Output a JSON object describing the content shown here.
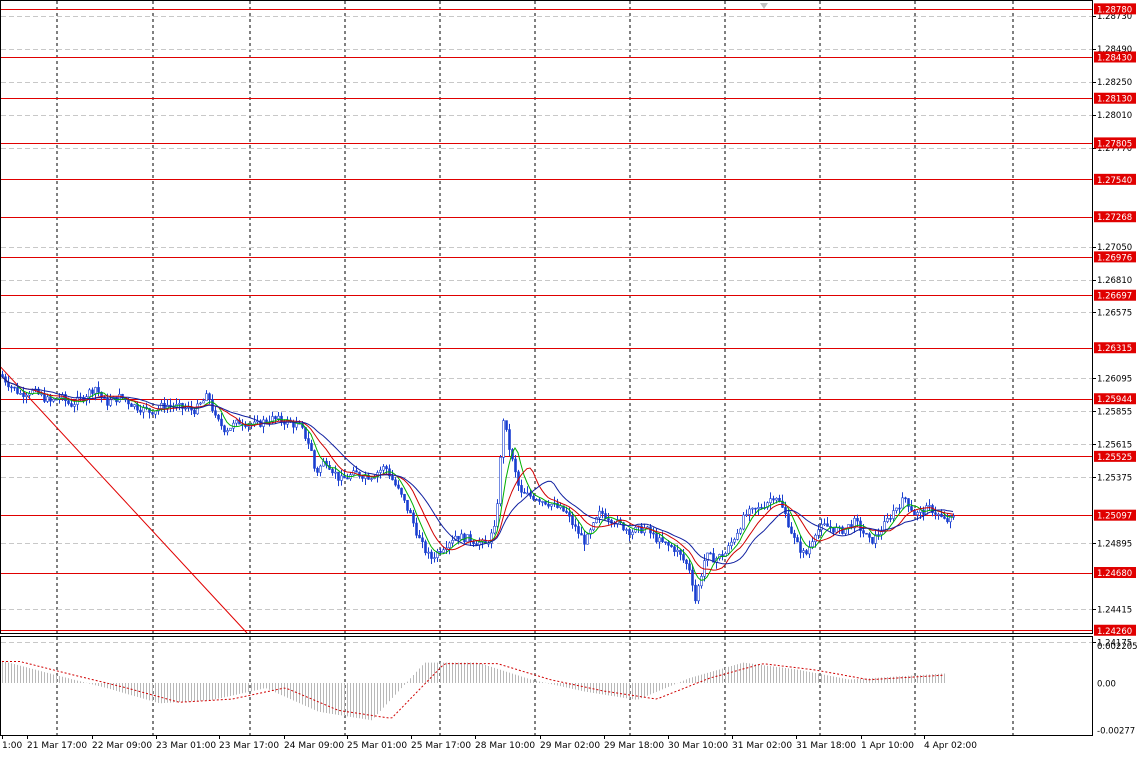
{
  "chart_data": {
    "type": "candlestick",
    "price_axis": {
      "range": [
        1.2424,
        1.2883
      ],
      "ticks": [
        "1.28730",
        "1.28490",
        "1.28250",
        "1.28010",
        "1.27770",
        "1.27050",
        "1.26810",
        "1.26575",
        "1.26095",
        "1.25855",
        "1.25615",
        "1.25375",
        "1.24895",
        "1.24415",
        "1.24175"
      ]
    },
    "time_axis": {
      "labels": [
        "1:00",
        "21 Mar 17:00",
        "22 Mar 09:00",
        "23 Mar 01:00",
        "23 Mar 17:00",
        "24 Mar 09:00",
        "25 Mar 01:00",
        "25 Mar 17:00",
        "28 Mar 10:00",
        "29 Mar 02:00",
        "29 Mar 18:00",
        "30 Mar 10:00",
        "31 Mar 02:00",
        "31 Mar 18:00",
        "1 Apr 10:00",
        "4 Apr 02:00"
      ]
    },
    "horizontal_levels": [
      "1.28780",
      "1.28430",
      "1.28130",
      "1.27805",
      "1.27540",
      "1.27268",
      "1.26976",
      "1.26697",
      "1.26315",
      "1.25944",
      "1.25525",
      "1.25097",
      "1.24680",
      "1.24260"
    ],
    "current_price": "1.25097",
    "price_path": [
      [
        0,
        1.2612
      ],
      [
        10,
        1.2604
      ],
      [
        20,
        1.2598
      ],
      [
        30,
        1.26
      ],
      [
        40,
        1.2597
      ],
      [
        50,
        1.2592
      ],
      [
        60,
        1.2596
      ],
      [
        70,
        1.259
      ],
      [
        80,
        1.2594
      ],
      [
        95,
        1.2603
      ],
      [
        105,
        1.2591
      ],
      [
        120,
        1.2596
      ],
      [
        135,
        1.2589
      ],
      [
        150,
        1.2585
      ],
      [
        165,
        1.259
      ],
      [
        180,
        1.2588
      ],
      [
        195,
        1.2586
      ],
      [
        208,
        1.2597
      ],
      [
        215,
        1.258
      ],
      [
        225,
        1.2572
      ],
      [
        240,
        1.2578
      ],
      [
        255,
        1.2575
      ],
      [
        270,
        1.258
      ],
      [
        285,
        1.2578
      ],
      [
        300,
        1.2574
      ],
      [
        310,
        1.256
      ],
      [
        315,
        1.254
      ],
      [
        325,
        1.255
      ],
      [
        340,
        1.2535
      ],
      [
        355,
        1.254
      ],
      [
        370,
        1.2538
      ],
      [
        385,
        1.2545
      ],
      [
        400,
        1.2525
      ],
      [
        410,
        1.251
      ],
      [
        420,
        1.249
      ],
      [
        430,
        1.2478
      ],
      [
        440,
        1.2485
      ],
      [
        455,
        1.2495
      ],
      [
        470,
        1.2492
      ],
      [
        485,
        1.2488
      ],
      [
        495,
        1.25
      ],
      [
        503,
        1.258
      ],
      [
        510,
        1.2555
      ],
      [
        520,
        1.2525
      ],
      [
        535,
        1.2523
      ],
      [
        550,
        1.2518
      ],
      [
        565,
        1.2512
      ],
      [
        575,
        1.25
      ],
      [
        585,
        1.249
      ],
      [
        600,
        1.2512
      ],
      [
        615,
        1.2505
      ],
      [
        630,
        1.2498
      ],
      [
        645,
        1.25
      ],
      [
        660,
        1.249
      ],
      [
        675,
        1.2485
      ],
      [
        690,
        1.247
      ],
      [
        695,
        1.2448
      ],
      [
        705,
        1.248
      ],
      [
        715,
        1.2478
      ],
      [
        725,
        1.2482
      ],
      [
        735,
        1.2495
      ],
      [
        745,
        1.251
      ],
      [
        760,
        1.2515
      ],
      [
        775,
        1.2525
      ],
      [
        785,
        1.251
      ],
      [
        795,
        1.249
      ],
      [
        805,
        1.248
      ],
      [
        815,
        1.2498
      ],
      [
        825,
        1.2502
      ],
      [
        840,
        1.2498
      ],
      [
        855,
        1.2505
      ],
      [
        870,
        1.249
      ],
      [
        880,
        1.2498
      ],
      [
        895,
        1.2515
      ],
      [
        905,
        1.2522
      ],
      [
        915,
        1.251
      ],
      [
        930,
        1.2515
      ],
      [
        945,
        1.2505
      ],
      [
        955,
        1.2508
      ]
    ],
    "oscillator": {
      "ticks": [
        "0.002205",
        "0.00",
        "-0.00277"
      ],
      "levels": [
        0.00133,
        0.0005,
        -0.0003,
        -0.0012,
        -0.001,
        -0.0003,
        -0.0017,
        -0.0022,
        0.0012,
        0.0012,
        0.0002,
        -0.0005,
        -0.001,
        0.0003,
        0.0012,
        0.0008,
        0.0002,
        0.0004,
        0.0006
      ]
    }
  }
}
